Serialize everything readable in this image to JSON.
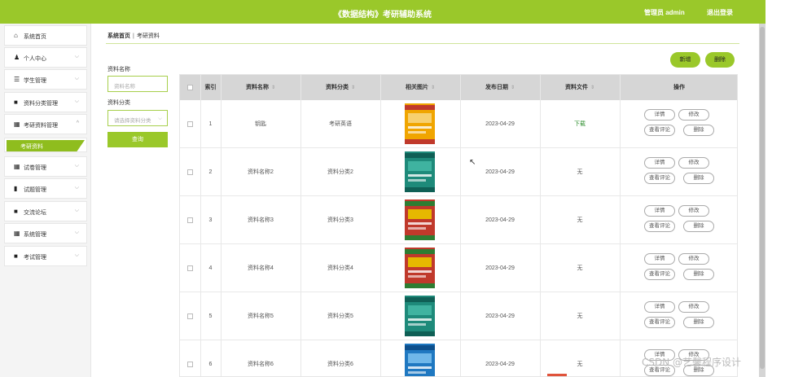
{
  "header": {
    "title": "《数据结构》考研辅助系统",
    "user": "管理员 admin",
    "logout": "退出登录"
  },
  "sidebar": {
    "items": [
      {
        "icon": "home-icon",
        "glyph": "⌂",
        "label": "系统首页",
        "chevron": false
      },
      {
        "icon": "user-icon",
        "glyph": "♟",
        "label": "个人中心",
        "chevron": true
      },
      {
        "icon": "sliders-icon",
        "glyph": "☰",
        "label": "学生管理",
        "chevron": true
      },
      {
        "icon": "folder-icon",
        "glyph": "■",
        "label": "资料分类管理",
        "chevron": true
      },
      {
        "icon": "grid-icon",
        "glyph": "▦",
        "label": "考研资料管理",
        "chevron": true,
        "expanded": true
      },
      {
        "icon": "grid-icon",
        "glyph": "▦",
        "label": "试卷管理",
        "chevron": true
      },
      {
        "icon": "bar-chart-icon",
        "glyph": "▮",
        "label": "试题管理",
        "chevron": true
      },
      {
        "icon": "clipboard-icon",
        "glyph": "■",
        "label": "交流论坛",
        "chevron": true
      },
      {
        "icon": "grid-icon",
        "glyph": "▦",
        "label": "系统管理",
        "chevron": true
      },
      {
        "icon": "clipboard-icon",
        "glyph": "■",
        "label": "考试管理",
        "chevron": true
      }
    ],
    "submenu_active": "考研资料"
  },
  "breadcrumb": {
    "home": "系统首页",
    "separator": "|",
    "current": "考研资料"
  },
  "filters": {
    "name_label": "资料名称",
    "name_placeholder": "资料名称",
    "category_label": "资料分类",
    "category_placeholder": "请选择资料分类",
    "search_button": "查询"
  },
  "actions": {
    "add": "新增",
    "delete": "删除"
  },
  "table": {
    "headers": [
      "索引",
      "资料名称",
      "资料分类",
      "相关图片",
      "发布日期",
      "资料文件",
      "操作"
    ],
    "rows": [
      {
        "index": "1",
        "name": "钥匙",
        "category": "考研英语",
        "date": "2023-04-29",
        "file": "下载",
        "cover": "yellow"
      },
      {
        "index": "2",
        "name": "资料名称2",
        "category": "资料分类2",
        "date": "2023-04-29",
        "file": "无",
        "cover": "teal"
      },
      {
        "index": "3",
        "name": "资料名称3",
        "category": "资料分类3",
        "date": "2023-04-29",
        "file": "无",
        "cover": "red"
      },
      {
        "index": "4",
        "name": "资料名称4",
        "category": "资料分类4",
        "date": "2023-04-29",
        "file": "无",
        "cover": "red"
      },
      {
        "index": "5",
        "name": "资料名称5",
        "category": "资料分类5",
        "date": "2023-04-29",
        "file": "无",
        "cover": "teal"
      },
      {
        "index": "6",
        "name": "资料名称6",
        "category": "资料分类6",
        "date": "2023-04-29",
        "file": "无",
        "cover": "blue"
      }
    ],
    "row_actions": {
      "detail": "详情",
      "edit": "修改",
      "comments": "查看评论",
      "delete": "删除"
    }
  },
  "colors": {
    "accent": "#9ac82a",
    "active": "#8fbd1e"
  },
  "watermark": "CSDN @艺馨程序设计"
}
